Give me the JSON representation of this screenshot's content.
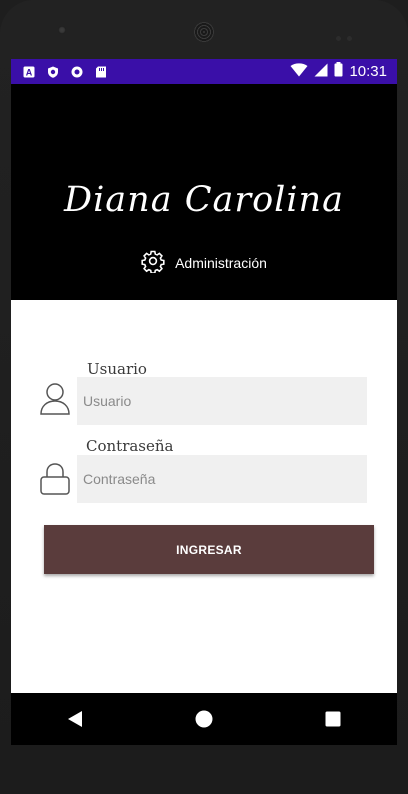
{
  "status_bar": {
    "time": "10:31",
    "background": "#3a0fa8",
    "left_icons": [
      "a-icon",
      "shield-icon",
      "circle-icon",
      "sd-card-icon"
    ],
    "right_icons": [
      "wifi-icon",
      "signal-icon",
      "battery-icon"
    ]
  },
  "hero": {
    "title": "Diana Carolina",
    "admin_label": "Administración",
    "background": "#000000"
  },
  "form": {
    "username_label": "Usuario",
    "username_placeholder": "Usuario",
    "username_value": "",
    "password_label": "Contraseña",
    "password_placeholder": "Contraseña",
    "password_value": "",
    "submit_label": "INGRESAR",
    "button_color": "#5a3c3c",
    "field_background": "#f0f0f0"
  },
  "nav_bar": {
    "buttons": [
      "back-icon",
      "home-icon",
      "recents-icon"
    ]
  }
}
